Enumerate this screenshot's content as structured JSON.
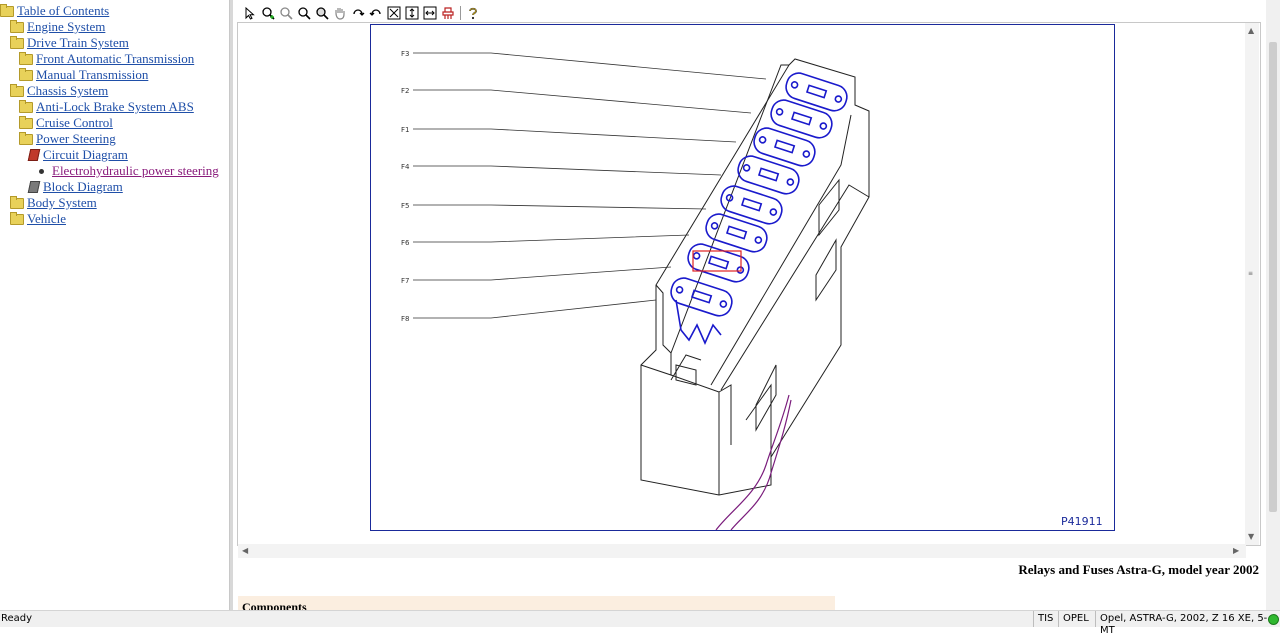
{
  "tree": {
    "items": [
      {
        "label": "Table of Contents",
        "icon": "folder-open-icon"
      },
      {
        "label": "Engine System",
        "icon": "folder-icon"
      },
      {
        "label": "Drive Train System",
        "icon": "folder-icon"
      },
      {
        "label": "Front Automatic Transmission",
        "icon": "folder-icon"
      },
      {
        "label": "Manual Transmission",
        "icon": "folder-icon"
      },
      {
        "label": "Chassis System",
        "icon": "folder-open-icon"
      },
      {
        "label": "Anti-Lock Brake System ABS",
        "icon": "folder-icon"
      },
      {
        "label": "Cruise Control",
        "icon": "folder-icon"
      },
      {
        "label": "Power Steering",
        "icon": "folder-open-icon"
      },
      {
        "label": "Circuit Diagram",
        "icon": "book-open-icon"
      },
      {
        "label": "Electrohydraulic power steering",
        "icon": "bullet-icon"
      },
      {
        "label": "Block Diagram",
        "icon": "book-icon"
      },
      {
        "label": "Body System",
        "icon": "folder-icon"
      },
      {
        "label": "Vehicle",
        "icon": "folder-icon"
      }
    ]
  },
  "toolbar": {
    "tools": [
      "select-arrow-icon",
      "zoom-in-icon",
      "zoom-out-icon",
      "zoom-icon",
      "zoom-area-icon",
      "pan-hand-icon",
      "rotate-cw-icon",
      "rotate-ccw-icon",
      "fit-page-icon",
      "fit-height-icon",
      "fit-width-icon",
      "highlight-icon",
      "help-icon"
    ]
  },
  "drawing": {
    "fuse_labels": [
      "F3",
      "F2",
      "F1",
      "F4",
      "F5",
      "F6",
      "F7",
      "F8"
    ],
    "figure_id": "P41911",
    "colors": {
      "frame": "#1a2a9a",
      "highlight": "#1a1acc",
      "selection": "#e02020",
      "wire": "#7a1c7c"
    }
  },
  "caption": "Relays and Fuses Astra-G, model year 2002",
  "section_heading": "Components",
  "status": {
    "text": "Ready",
    "system": "TIS",
    "brand": "OPEL",
    "vehicle": "Opel, ASTRA-G, 2002, Z 16 XE, 5-MT",
    "led_color": "#2fb82f"
  }
}
